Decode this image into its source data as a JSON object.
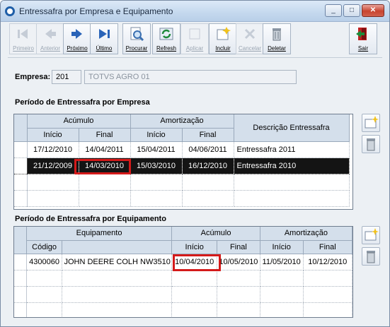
{
  "window": {
    "title": "Entressafra por Empresa e Equipamento",
    "min": "_",
    "max": "□",
    "close": "✕"
  },
  "toolbar": {
    "buttons": [
      {
        "label": "Primeiro",
        "icon": "first-record-icon",
        "enabled": false
      },
      {
        "label": "Anterior",
        "icon": "previous-record-icon",
        "enabled": false
      },
      {
        "label": "Próximo",
        "icon": "next-record-icon",
        "enabled": true
      },
      {
        "label": "Último",
        "icon": "last-record-icon",
        "enabled": true
      },
      {
        "label": "Procurar",
        "icon": "search-icon",
        "enabled": true
      },
      {
        "label": "Refresh",
        "icon": "refresh-icon",
        "enabled": true
      },
      {
        "label": "Aplicar",
        "icon": "apply-icon",
        "enabled": false
      },
      {
        "label": "Incluir",
        "icon": "add-icon",
        "enabled": true
      },
      {
        "label": "Cancelar",
        "icon": "cancel-icon",
        "enabled": false
      },
      {
        "label": "Deletar",
        "icon": "delete-icon",
        "enabled": true
      },
      {
        "label": "Sair",
        "icon": "exit-icon",
        "enabled": true
      }
    ]
  },
  "empresa": {
    "label": "Empresa:",
    "code": "201",
    "name": "TOTVS AGRO 01"
  },
  "section1": {
    "title": "Período de Entressafra por Empresa",
    "group1": "Acúmulo",
    "group2": "Amortização",
    "col5": "Descrição Entressafra",
    "sub": [
      "Início",
      "Final",
      "Início",
      "Final"
    ],
    "rows": [
      [
        "17/12/2010",
        "14/04/2011",
        "15/04/2011",
        "04/06/2011",
        "Entressafra 2011"
      ],
      [
        "21/12/2009",
        "14/03/2010",
        "15/03/2010",
        "16/12/2010",
        "Entressafra 2010"
      ]
    ]
  },
  "section2": {
    "title": "Período de Entressafra por Equipamento",
    "group1": "Equipamento",
    "group2": "Acúmulo",
    "group3": "Amortização",
    "sub": [
      "Código",
      "",
      "Início",
      "Final",
      "Início",
      "Final"
    ],
    "rows": [
      [
        "4300060",
        "JOHN DEERE COLH NW3510",
        "10/04/2010",
        "10/05/2010",
        "11/05/2010",
        "10/12/2010"
      ]
    ]
  },
  "colors": {
    "highlight": "#d41a1a",
    "selected_row": "#141414",
    "header": "#d4dfeb"
  }
}
